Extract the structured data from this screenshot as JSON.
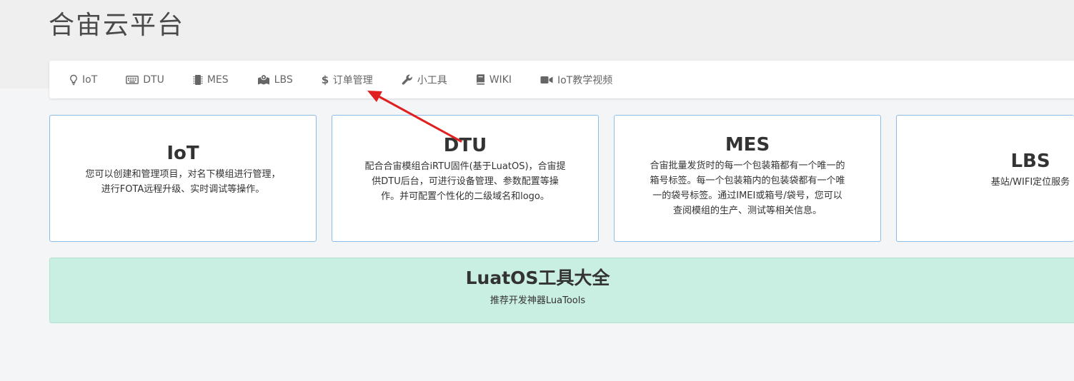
{
  "header": {
    "title": "合宙云平台"
  },
  "nav": {
    "items": [
      {
        "label": "IoT",
        "icon": "lightbulb-icon"
      },
      {
        "label": "DTU",
        "icon": "keyboard-icon"
      },
      {
        "label": "MES",
        "icon": "chip-icon"
      },
      {
        "label": "LBS",
        "icon": "map-icon"
      },
      {
        "label": "订单管理",
        "icon": "dollar-icon"
      },
      {
        "label": "小工具",
        "icon": "wrench-icon"
      },
      {
        "label": "WIKI",
        "icon": "book-icon"
      },
      {
        "label": "IoT教学视频",
        "icon": "video-camera-icon"
      }
    ]
  },
  "cards": [
    {
      "title": "IoT",
      "lines": [
        "您可以创建和管理项目，对名下模组进行管理，",
        "进行FOTA远程升级、实时调试等操作。"
      ]
    },
    {
      "title": "DTU",
      "lines": [
        "配合合宙模组合iRTU固件(基于LuatOS)，合宙提",
        "供DTU后台，可进行设备管理、参数配置等操",
        "作。并可配置个性化的二级域名和logo。"
      ]
    },
    {
      "title": "MES",
      "lines": [
        "合宙批量发货时的每一个包装箱都有一个唯一的",
        "箱号标签。每一个包装箱内的包装袋都有一个唯",
        "一的袋号标签。通过IMEI或箱号/袋号，您可以",
        "查阅模组的生产、测试等相关信息。"
      ]
    },
    {
      "title": "LBS",
      "lines": [
        "基站/WIFI定位服务"
      ]
    }
  ],
  "banner": {
    "title": "LuatOS工具大全",
    "subtitle": "推荐开发神器LuaTools"
  },
  "colors": {
    "arrow": "#e02020",
    "card_border": "#8bbde8",
    "banner_bg": "#c9eee2"
  }
}
